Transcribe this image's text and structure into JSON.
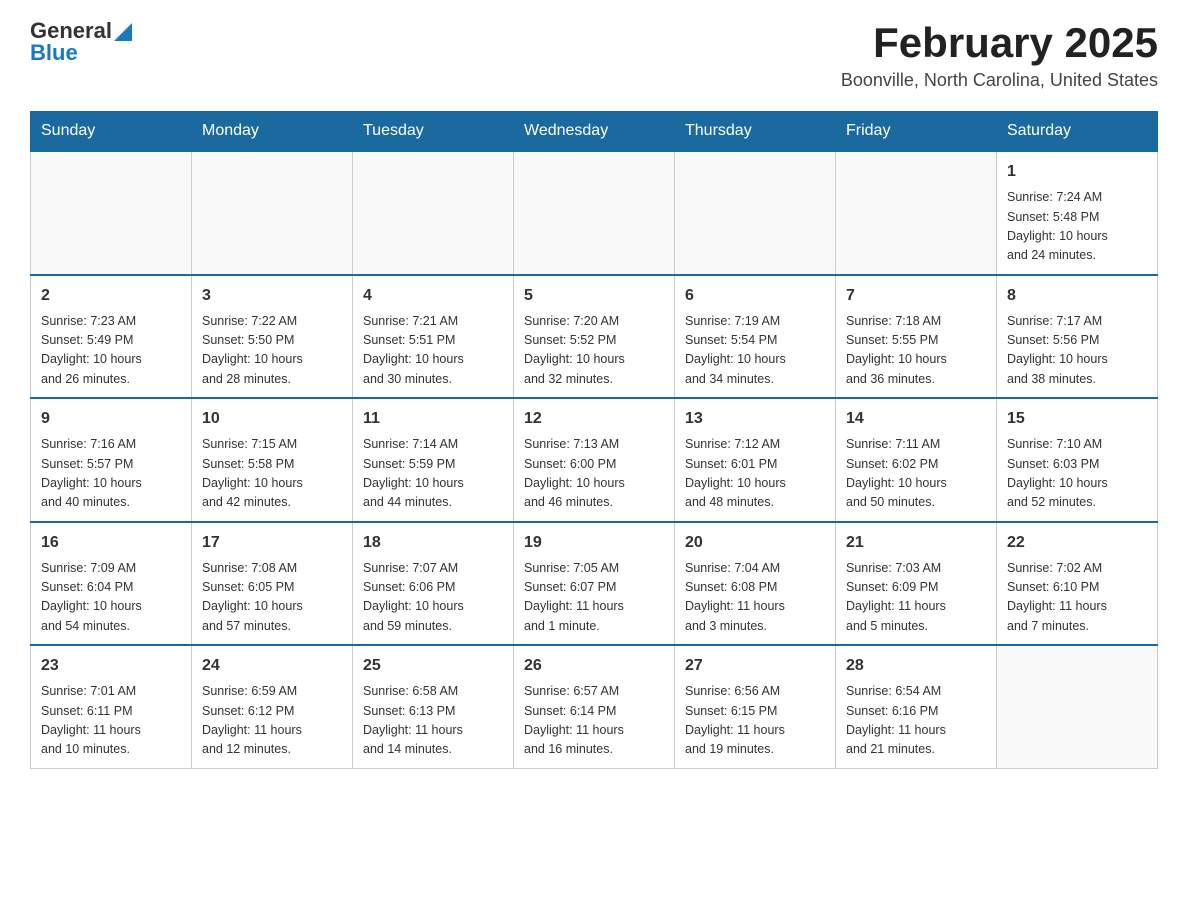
{
  "logo": {
    "general": "General",
    "arrow": "▶",
    "blue": "Blue"
  },
  "title": "February 2025",
  "subtitle": "Boonville, North Carolina, United States",
  "days_of_week": [
    "Sunday",
    "Monday",
    "Tuesday",
    "Wednesday",
    "Thursday",
    "Friday",
    "Saturday"
  ],
  "weeks": [
    [
      {
        "day": "",
        "info": ""
      },
      {
        "day": "",
        "info": ""
      },
      {
        "day": "",
        "info": ""
      },
      {
        "day": "",
        "info": ""
      },
      {
        "day": "",
        "info": ""
      },
      {
        "day": "",
        "info": ""
      },
      {
        "day": "1",
        "info": "Sunrise: 7:24 AM\nSunset: 5:48 PM\nDaylight: 10 hours\nand 24 minutes."
      }
    ],
    [
      {
        "day": "2",
        "info": "Sunrise: 7:23 AM\nSunset: 5:49 PM\nDaylight: 10 hours\nand 26 minutes."
      },
      {
        "day": "3",
        "info": "Sunrise: 7:22 AM\nSunset: 5:50 PM\nDaylight: 10 hours\nand 28 minutes."
      },
      {
        "day": "4",
        "info": "Sunrise: 7:21 AM\nSunset: 5:51 PM\nDaylight: 10 hours\nand 30 minutes."
      },
      {
        "day": "5",
        "info": "Sunrise: 7:20 AM\nSunset: 5:52 PM\nDaylight: 10 hours\nand 32 minutes."
      },
      {
        "day": "6",
        "info": "Sunrise: 7:19 AM\nSunset: 5:54 PM\nDaylight: 10 hours\nand 34 minutes."
      },
      {
        "day": "7",
        "info": "Sunrise: 7:18 AM\nSunset: 5:55 PM\nDaylight: 10 hours\nand 36 minutes."
      },
      {
        "day": "8",
        "info": "Sunrise: 7:17 AM\nSunset: 5:56 PM\nDaylight: 10 hours\nand 38 minutes."
      }
    ],
    [
      {
        "day": "9",
        "info": "Sunrise: 7:16 AM\nSunset: 5:57 PM\nDaylight: 10 hours\nand 40 minutes."
      },
      {
        "day": "10",
        "info": "Sunrise: 7:15 AM\nSunset: 5:58 PM\nDaylight: 10 hours\nand 42 minutes."
      },
      {
        "day": "11",
        "info": "Sunrise: 7:14 AM\nSunset: 5:59 PM\nDaylight: 10 hours\nand 44 minutes."
      },
      {
        "day": "12",
        "info": "Sunrise: 7:13 AM\nSunset: 6:00 PM\nDaylight: 10 hours\nand 46 minutes."
      },
      {
        "day": "13",
        "info": "Sunrise: 7:12 AM\nSunset: 6:01 PM\nDaylight: 10 hours\nand 48 minutes."
      },
      {
        "day": "14",
        "info": "Sunrise: 7:11 AM\nSunset: 6:02 PM\nDaylight: 10 hours\nand 50 minutes."
      },
      {
        "day": "15",
        "info": "Sunrise: 7:10 AM\nSunset: 6:03 PM\nDaylight: 10 hours\nand 52 minutes."
      }
    ],
    [
      {
        "day": "16",
        "info": "Sunrise: 7:09 AM\nSunset: 6:04 PM\nDaylight: 10 hours\nand 54 minutes."
      },
      {
        "day": "17",
        "info": "Sunrise: 7:08 AM\nSunset: 6:05 PM\nDaylight: 10 hours\nand 57 minutes."
      },
      {
        "day": "18",
        "info": "Sunrise: 7:07 AM\nSunset: 6:06 PM\nDaylight: 10 hours\nand 59 minutes."
      },
      {
        "day": "19",
        "info": "Sunrise: 7:05 AM\nSunset: 6:07 PM\nDaylight: 11 hours\nand 1 minute."
      },
      {
        "day": "20",
        "info": "Sunrise: 7:04 AM\nSunset: 6:08 PM\nDaylight: 11 hours\nand 3 minutes."
      },
      {
        "day": "21",
        "info": "Sunrise: 7:03 AM\nSunset: 6:09 PM\nDaylight: 11 hours\nand 5 minutes."
      },
      {
        "day": "22",
        "info": "Sunrise: 7:02 AM\nSunset: 6:10 PM\nDaylight: 11 hours\nand 7 minutes."
      }
    ],
    [
      {
        "day": "23",
        "info": "Sunrise: 7:01 AM\nSunset: 6:11 PM\nDaylight: 11 hours\nand 10 minutes."
      },
      {
        "day": "24",
        "info": "Sunrise: 6:59 AM\nSunset: 6:12 PM\nDaylight: 11 hours\nand 12 minutes."
      },
      {
        "day": "25",
        "info": "Sunrise: 6:58 AM\nSunset: 6:13 PM\nDaylight: 11 hours\nand 14 minutes."
      },
      {
        "day": "26",
        "info": "Sunrise: 6:57 AM\nSunset: 6:14 PM\nDaylight: 11 hours\nand 16 minutes."
      },
      {
        "day": "27",
        "info": "Sunrise: 6:56 AM\nSunset: 6:15 PM\nDaylight: 11 hours\nand 19 minutes."
      },
      {
        "day": "28",
        "info": "Sunrise: 6:54 AM\nSunset: 6:16 PM\nDaylight: 11 hours\nand 21 minutes."
      },
      {
        "day": "",
        "info": ""
      }
    ]
  ]
}
